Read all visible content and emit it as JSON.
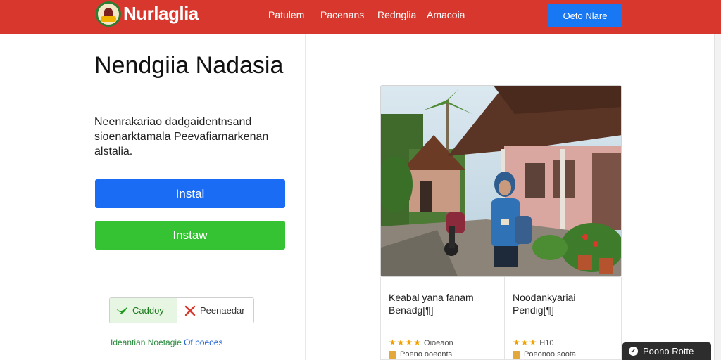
{
  "header": {
    "brand": "Nurlaglia",
    "nav": [
      "Patulem",
      "Pacenans",
      "Rednglia",
      "Amacoia"
    ],
    "cta_label": "Oeto Nlare"
  },
  "hero": {
    "title": "Nendgiia Nadasia",
    "description": "Neenrakariao dadgaidentnsand sioenarktamala Peevafiarnarkenan alstalia.",
    "install_primary": "Instal",
    "install_secondary": "Instaw"
  },
  "actions": {
    "left_label": "Caddoy",
    "right_label": "Peenaedar"
  },
  "footer_link": {
    "text": "Ideantian Noetagie",
    "accent": "Of boeoes"
  },
  "cards": [
    {
      "title": "Keabal yana fanam Benadg[¶]",
      "rating_text": "Oioeaon",
      "meta": "Poeno ooeonts"
    },
    {
      "title": "Noodankyariai Pendig[¶]",
      "rating_text": "H10",
      "meta": "Poeonoo soota"
    }
  ],
  "toast": {
    "label": "Poono Rotte"
  },
  "colors": {
    "header": "#d8372d",
    "install_primary": "#1a6cf5",
    "install_secondary": "#35c233",
    "cta": "#1877f2",
    "star": "#f2a100"
  }
}
